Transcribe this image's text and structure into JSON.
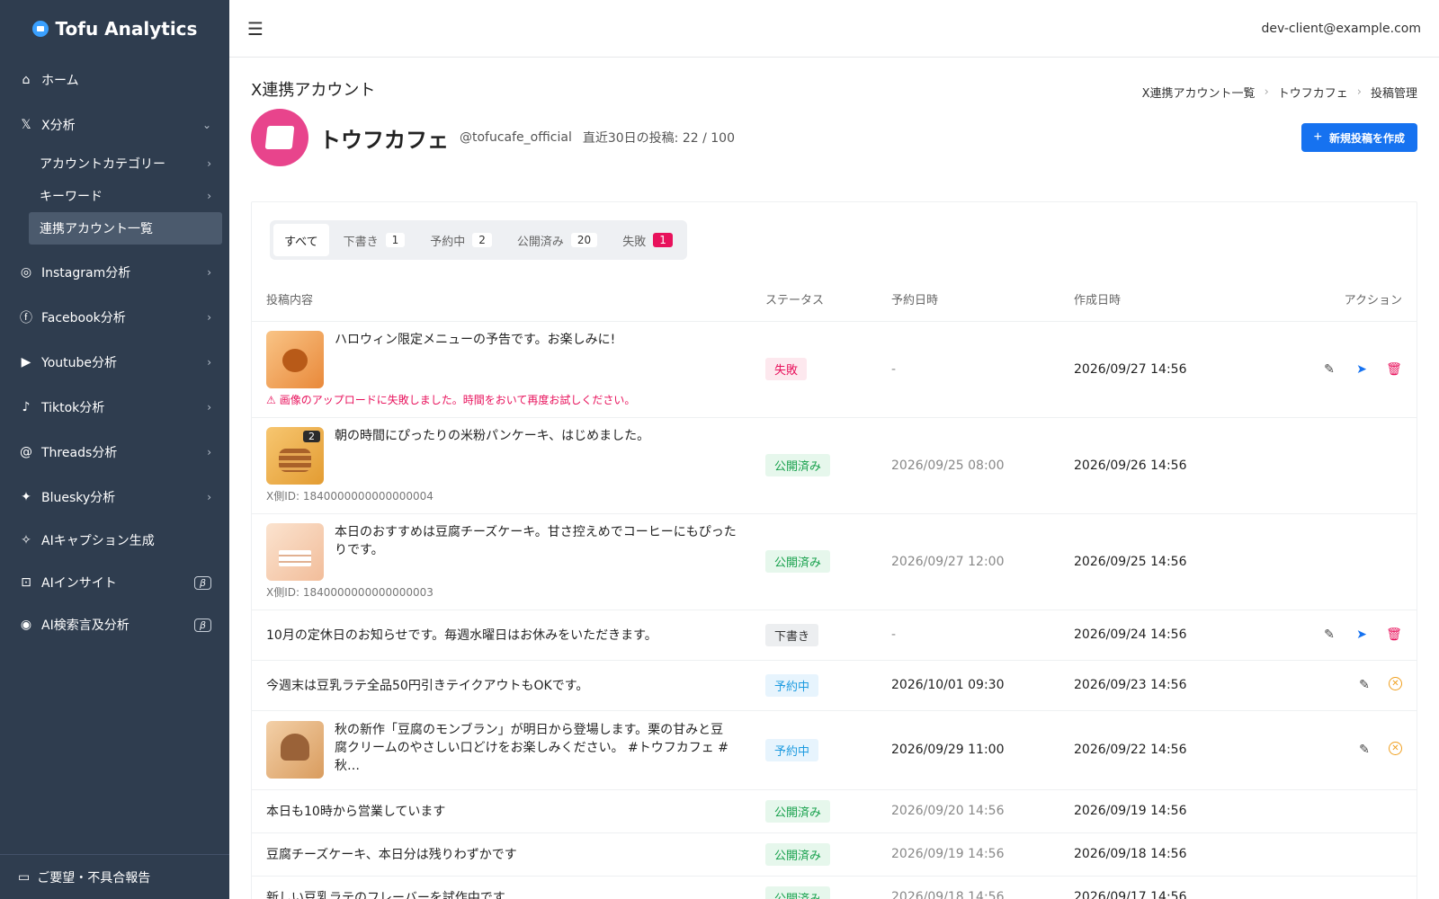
{
  "app": {
    "name": "Tofu Analytics",
    "menu_icon": "hamburger-icon",
    "user_email": "dev-client@example.com"
  },
  "sidebar": {
    "home": "ホーム",
    "x": "X分析",
    "x_sub": [
      "アカウントカテゴリー",
      "キーワード",
      "連携アカウント一覧"
    ],
    "instagram": "Instagram分析",
    "facebook": "Facebook分析",
    "youtube": "Youtube分析",
    "tiktok": "Tiktok分析",
    "threads": "Threads分析",
    "bluesky": "Bluesky分析",
    "ai_caption": "AIキャプション生成",
    "ai_insight": "AIインサイト",
    "ai_search": "AI検索言及分析",
    "beta": "β",
    "feedback": "ご要望・不具合報告"
  },
  "page": {
    "title": "X連携アカウント",
    "breadcrumb": [
      "X連携アカウント一覧",
      "トウフカフェ",
      "投稿管理"
    ]
  },
  "account": {
    "name": "トウフカフェ",
    "handle": "@tofucafe_official",
    "post_count": "直近30日の投稿: 22 / 100",
    "avatar_color": "#e8448c"
  },
  "new_post_button": "新規投稿を作成",
  "tabs": [
    {
      "label": "すべて",
      "count": ""
    },
    {
      "label": "下書き",
      "count": "1"
    },
    {
      "label": "予約中",
      "count": "2"
    },
    {
      "label": "公開済み",
      "count": "20"
    },
    {
      "label": "失敗",
      "count": "1"
    }
  ],
  "table": {
    "headers": [
      "投稿内容",
      "ステータス",
      "予約日時",
      "作成日時",
      "アクション"
    ],
    "rows": [
      {
        "text": "ハロウィン限定メニューの予告です。お楽しみに!",
        "note": "画像のアップロードに失敗しました。時間をおいて再度お試しください。",
        "status": "失敗",
        "scheduled": "-",
        "created": "2026/09/27 14:56"
      },
      {
        "text": "朝の時間にぴったりの米粉パンケーキ、はじめました。",
        "note": "X側ID: 1840000000000000004",
        "image_count": "2",
        "status": "公開済み",
        "scheduled": "2026/09/25 08:00",
        "created": "2026/09/26 14:56"
      },
      {
        "text": "本日のおすすめは豆腐チーズケーキ。甘さ控えめでコーヒーにもぴったりです。",
        "note": "X側ID: 1840000000000000003",
        "status": "公開済み",
        "scheduled": "2026/09/27 12:00",
        "created": "2026/09/25 14:56"
      },
      {
        "text": "10月の定休日のお知らせです。毎週水曜日はお休みをいただきます。",
        "status": "下書き",
        "scheduled": "-",
        "created": "2026/09/24 14:56"
      },
      {
        "text": "今週末は豆乳ラテ全品50円引きテイクアウトもOKです。",
        "status": "予約中",
        "scheduled": "2026/10/01 09:30",
        "created": "2026/09/23 14:56"
      },
      {
        "text": "秋の新作「豆腐のモンブラン」が明日から登場します。栗の甘みと豆腐クリームのやさしい口どけをお楽しみください。 #トウフカフェ #秋…",
        "status": "予約中",
        "scheduled": "2026/09/29 11:00",
        "created": "2026/09/22 14:56"
      },
      {
        "text": "本日も10時から営業しています",
        "status": "公開済み",
        "scheduled": "2026/09/20 14:56",
        "created": "2026/09/19 14:56"
      },
      {
        "text": "豆腐チーズケーキ、本日分は残りわずかです",
        "status": "公開済み",
        "scheduled": "2026/09/19 14:56",
        "created": "2026/09/18 14:56"
      },
      {
        "text": "新しい豆乳ラテのフレーバーを試作中です",
        "status": "公開済み",
        "scheduled": "2026/09/18 14:56",
        "created": "2026/09/17 14:56"
      }
    ]
  }
}
